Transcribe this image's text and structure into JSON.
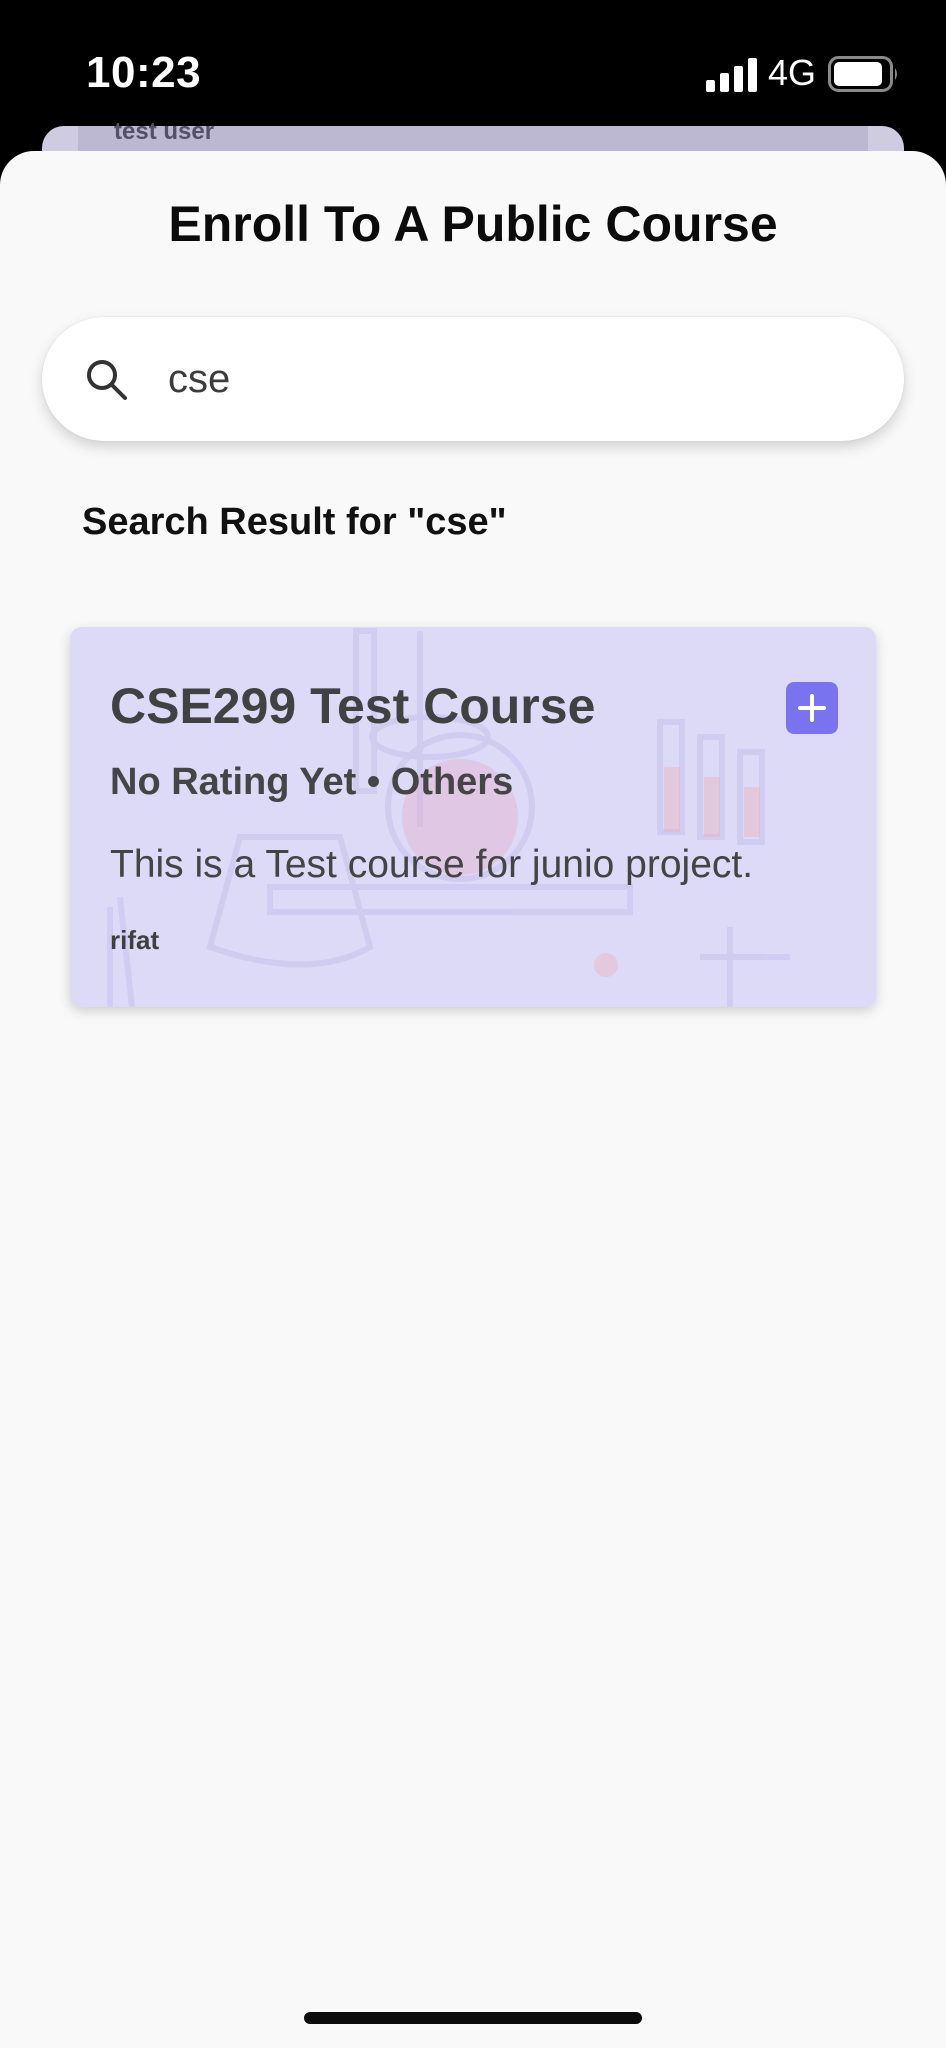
{
  "status_bar": {
    "time": "10:23",
    "network": "4G",
    "icons": [
      "signal-icon",
      "battery-icon"
    ]
  },
  "background_card": {
    "author": "test user"
  },
  "sheet": {
    "title": "Enroll To A Public Course"
  },
  "search": {
    "value": "cse",
    "icon": "search-icon"
  },
  "results": {
    "heading": "Search Result for \"cse\"",
    "courses": [
      {
        "title": "CSE299 Test Course",
        "meta": "No Rating Yet • Others",
        "description": "This is a Test course for junio project.",
        "author": "rifat",
        "action_icon": "plus-icon"
      }
    ]
  },
  "colors": {
    "accent": "#7a73ef",
    "card_background": "#dcdaf6",
    "sheet_background": "#f9f9f9"
  }
}
